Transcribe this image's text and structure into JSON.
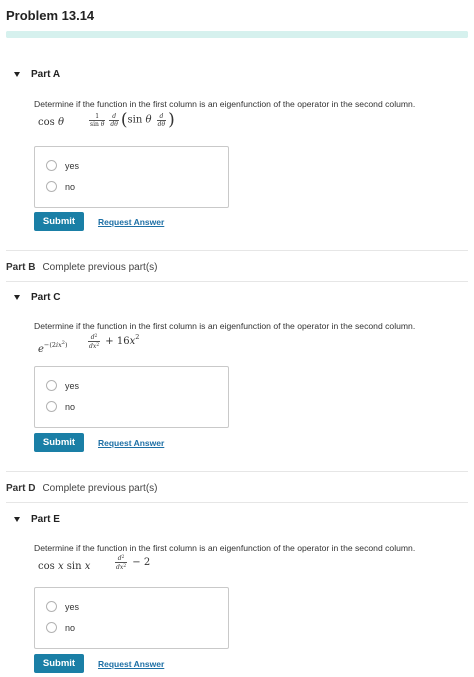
{
  "header": {
    "title": "Problem 13.14"
  },
  "progress": {
    "fraction": 1.0
  },
  "common": {
    "question": "Determine if the function in the first column is an eigenfunction of the operator in the second column.",
    "submit_label": "Submit",
    "request_label": "Request Answer"
  },
  "parts": [
    {
      "label": "Part A",
      "function": "cos θ",
      "operator": "(1 / sin θ) d/dθ ( sin θ d/dθ )",
      "options": [
        "yes",
        "no"
      ]
    },
    {
      "label": "Part B",
      "status": "Complete previous part(s)"
    },
    {
      "label": "Part C",
      "function": "e^{-(2ix^2)}",
      "operator": "d²/dx² + 16x²",
      "options": [
        "yes",
        "no"
      ]
    },
    {
      "label": "Part D",
      "status": "Complete previous part(s)"
    },
    {
      "label": "Part E",
      "function": "cos x sin x",
      "operator": "d²/dx² − 2",
      "options": [
        "yes",
        "no"
      ]
    }
  ],
  "colors": {
    "accent": "#1a7fa6",
    "link": "#1d6fa5",
    "progress": "#d6f1ee",
    "border": "#c9c9c9"
  }
}
